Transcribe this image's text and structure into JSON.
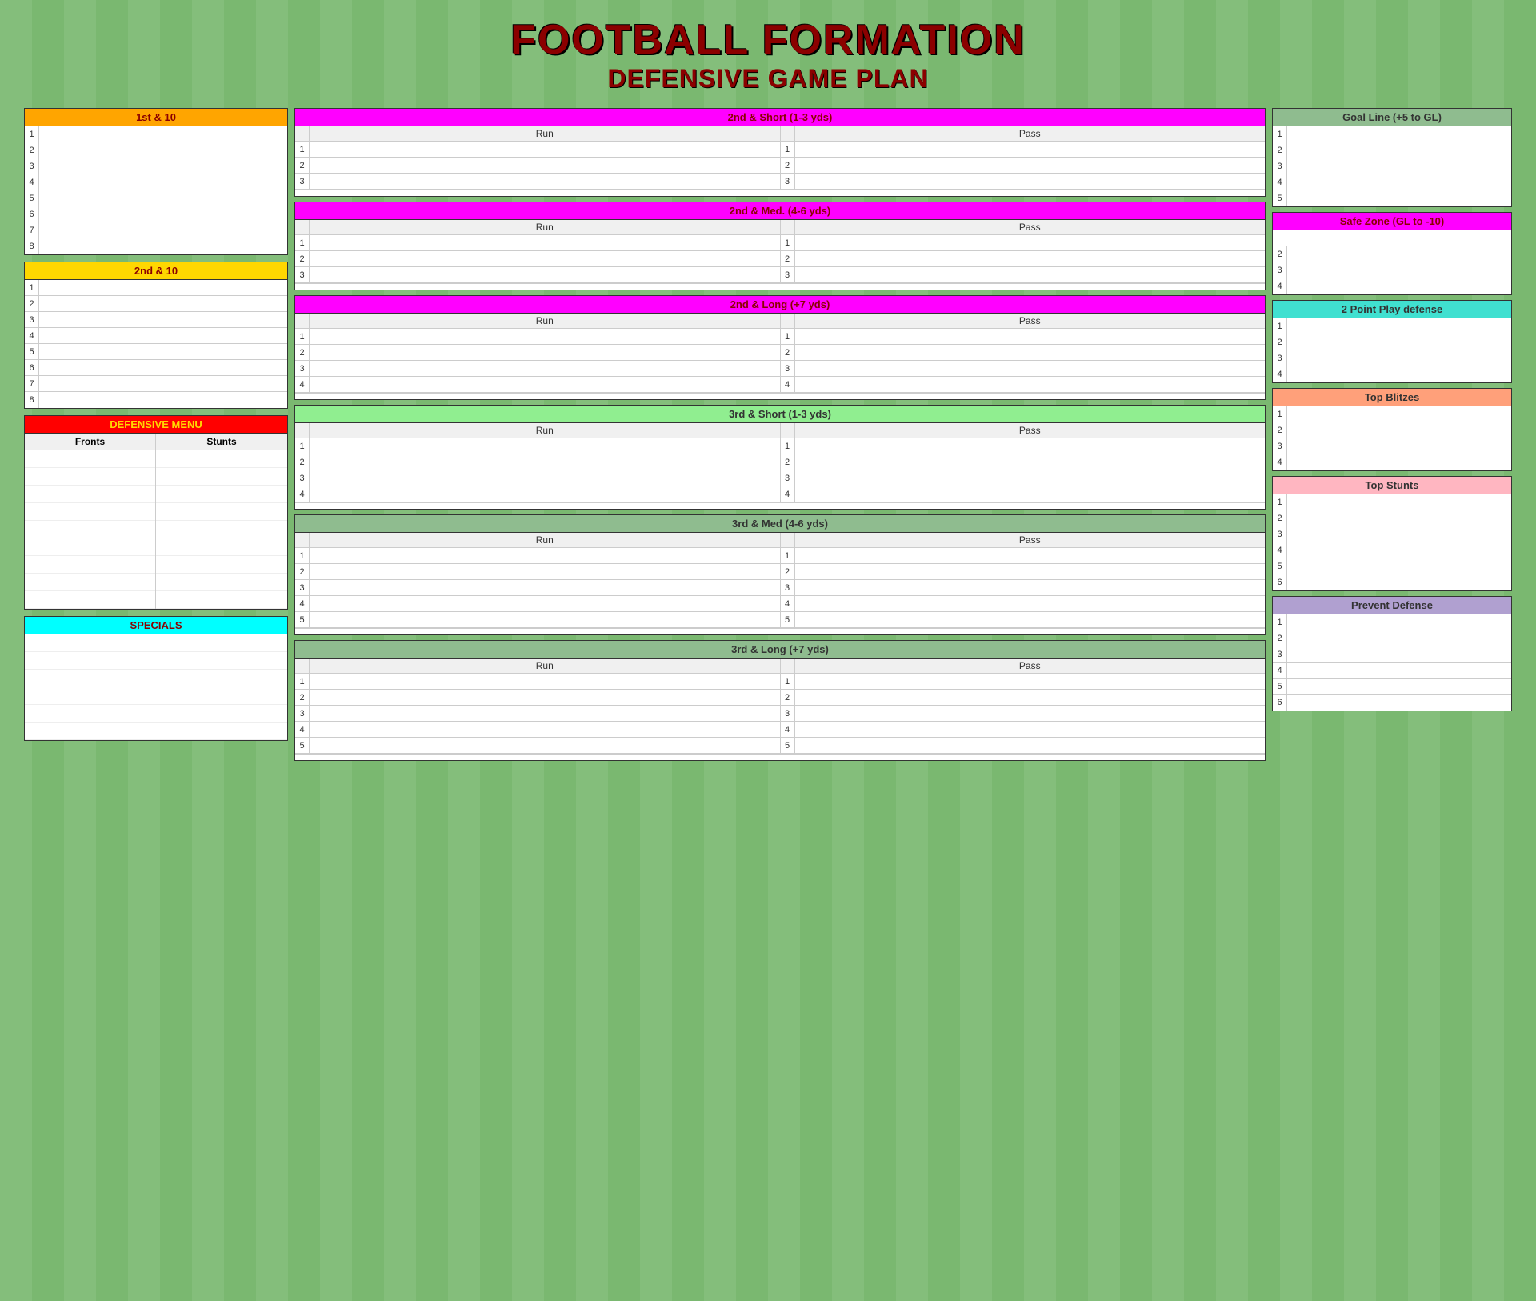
{
  "title": {
    "line1": "FOOTBALL FORMATION",
    "line2": "DEFENSIVE GAME PLAN"
  },
  "left": {
    "first_and_10": {
      "header": "1st & 10",
      "rows": 8
    },
    "second_and_10": {
      "header": "2nd & 10",
      "rows": 8
    },
    "defensive_menu": {
      "header": "DEFENSIVE MENU",
      "col1": "Fronts",
      "col2": "Stunts",
      "rows": 9
    },
    "specials": {
      "header": "SPECIALS",
      "rows": 6
    }
  },
  "middle": {
    "second_short": {
      "header": "2nd & Short (1-3 yds)",
      "run_label": "Run",
      "pass_label": "Pass",
      "rows": 3
    },
    "second_med": {
      "header": "2nd & Med. (4-6 yds)",
      "run_label": "Run",
      "pass_label": "Pass",
      "rows": 3
    },
    "second_long": {
      "header": "2nd & Long (+7 yds)",
      "run_label": "Run",
      "pass_label": "Pass",
      "rows": 4
    },
    "third_short": {
      "header": "3rd & Short (1-3 yds)",
      "run_label": "Run",
      "pass_label": "Pass",
      "rows": 4
    },
    "third_med": {
      "header": "3rd & Med (4-6 yds)",
      "run_label": "Run",
      "pass_label": "Pass",
      "rows": 5
    },
    "third_long": {
      "header": "3rd & Long (+7 yds)",
      "run_label": "Run",
      "pass_label": "Pass",
      "rows": 5
    }
  },
  "right": {
    "goal_line": {
      "header": "Goal Line (+5 to GL)",
      "rows": 5
    },
    "safe_zone": {
      "header": "Safe Zone (GL to -10)",
      "rows": 4
    },
    "two_point": {
      "header": "2 Point Play defense",
      "rows": 4
    },
    "top_blitzes": {
      "header": "Top Blitzes",
      "rows": 4
    },
    "top_stunts": {
      "header": "Top Stunts",
      "rows": 6
    },
    "prevent": {
      "header": "Prevent Defense",
      "rows": 6
    }
  }
}
